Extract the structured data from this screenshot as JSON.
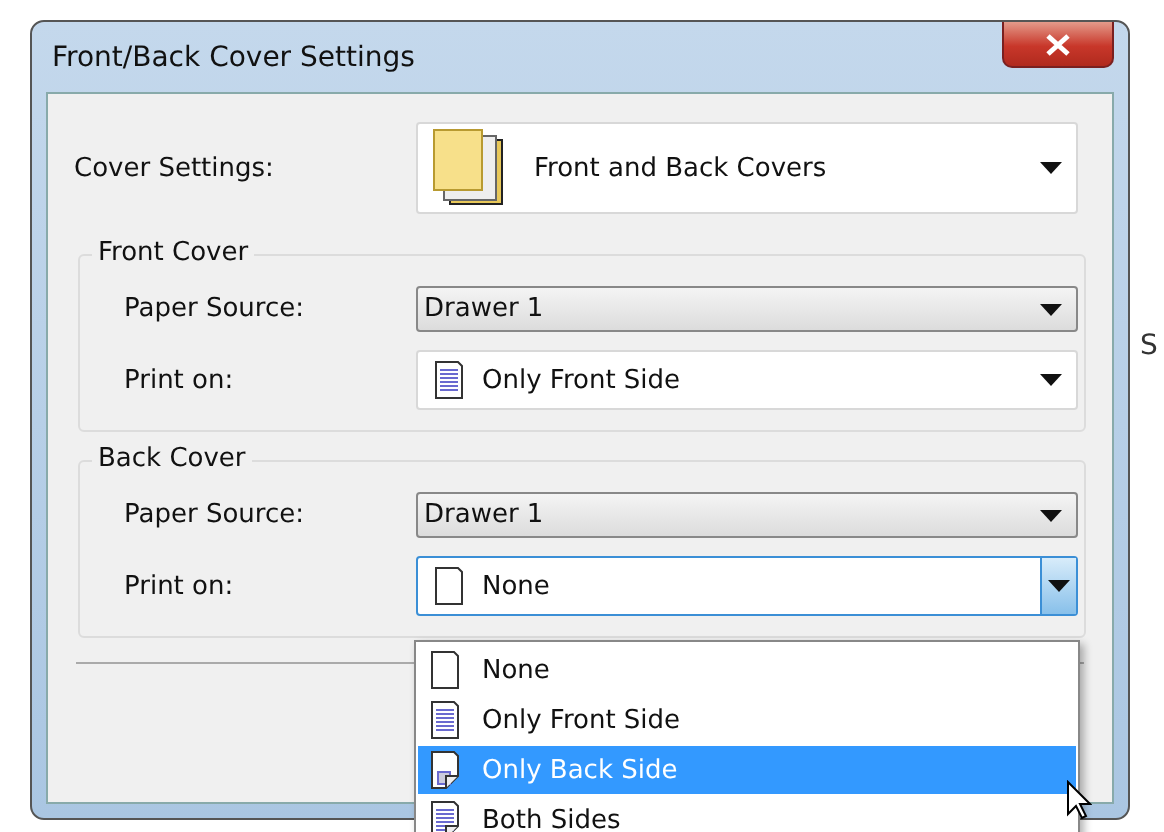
{
  "window": {
    "title": "Front/Back Cover Settings"
  },
  "background": {
    "text": "S"
  },
  "cover_settings": {
    "label": "Cover Settings:",
    "value": "Front and Back Covers",
    "kind": "stack"
  },
  "groups": [
    {
      "title": "Front Cover",
      "paper_source": {
        "label": "Paper Source:",
        "value": "Drawer 1"
      },
      "print_on": {
        "label": "Print on:",
        "value": "Only Front Side",
        "kind": "front",
        "expanded": false
      }
    },
    {
      "title": "Back Cover",
      "paper_source": {
        "label": "Paper Source:",
        "value": "Drawer 1"
      },
      "print_on": {
        "label": "Print on:",
        "value": "None",
        "kind": "none",
        "expanded": true
      }
    }
  ],
  "dropdown": {
    "items": [
      {
        "label": "None",
        "kind": "none",
        "selected": false
      },
      {
        "label": "Only Front Side",
        "kind": "front",
        "selected": false
      },
      {
        "label": "Only Back Side",
        "kind": "back",
        "selected": true
      },
      {
        "label": "Both Sides",
        "kind": "both",
        "selected": false
      }
    ]
  }
}
